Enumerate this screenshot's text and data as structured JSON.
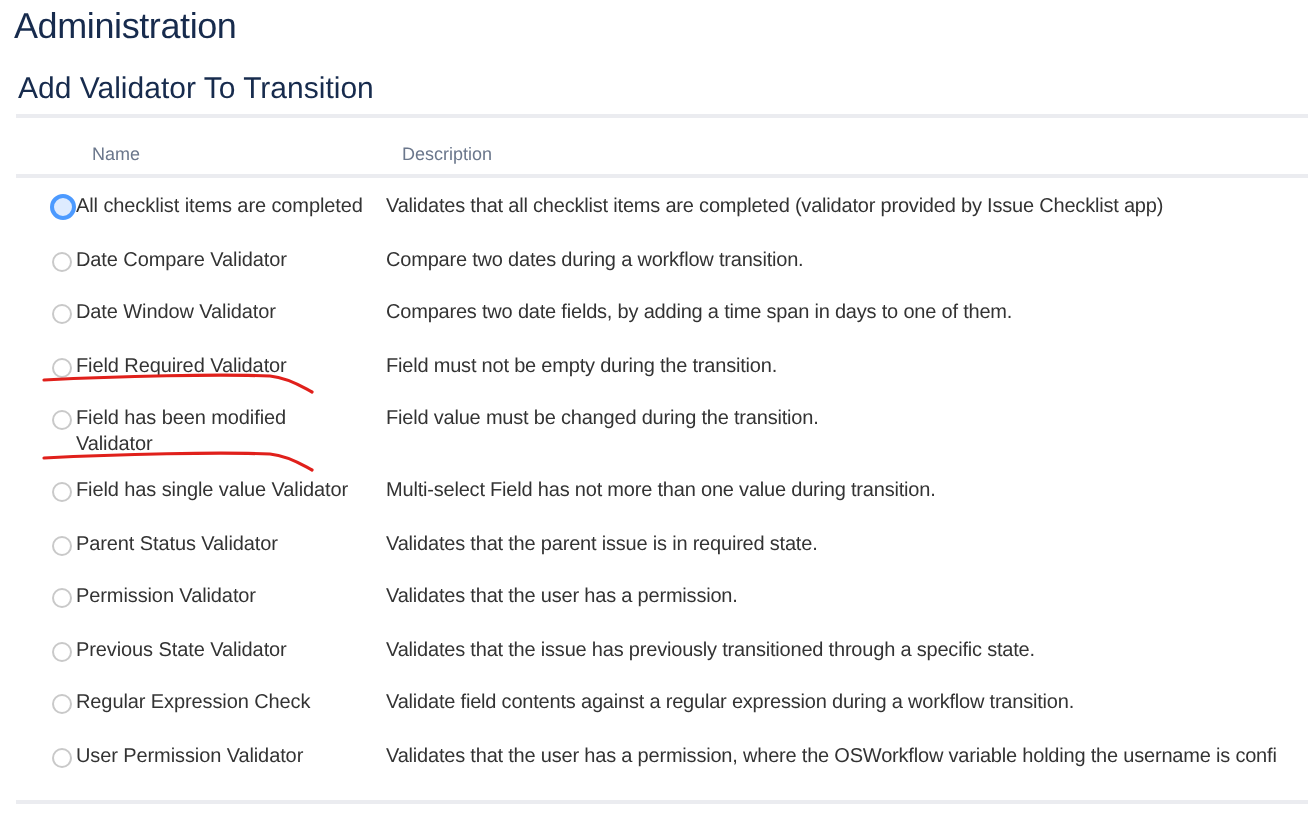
{
  "page_title": "Administration",
  "section_title": "Add Validator To Transition",
  "table": {
    "columns": [
      "Name",
      "Description"
    ],
    "rows": [
      {
        "name": "All checklist items are completed",
        "description": "Validates that all checklist items are completed (validator provided by Issue Checklist app)",
        "selected": true,
        "underlined": false
      },
      {
        "name": "Date Compare Validator",
        "description": "Compare two dates during a workflow transition.",
        "selected": false,
        "underlined": false
      },
      {
        "name": "Date Window Validator",
        "description": "Compares two date fields, by adding a time span in days to one of them.",
        "selected": false,
        "underlined": false
      },
      {
        "name": "Field Required Validator",
        "description": "Field must not be empty during the transition.",
        "selected": false,
        "underlined": true
      },
      {
        "name": "Field has been modified Validator",
        "description": "Field value must be changed during the transition.",
        "selected": false,
        "underlined": true
      },
      {
        "name": "Field has single value Validator",
        "description": "Multi-select Field has not more than one value during transition.",
        "selected": false,
        "underlined": false
      },
      {
        "name": "Parent Status Validator",
        "description": "Validates that the parent issue is in required state.",
        "selected": false,
        "underlined": false
      },
      {
        "name": "Permission Validator",
        "description": "Validates that the user has a permission.",
        "selected": false,
        "underlined": false
      },
      {
        "name": "Previous State Validator",
        "description": "Validates that the issue has previously transitioned through a specific state.",
        "selected": false,
        "underlined": false
      },
      {
        "name": "Regular Expression Check",
        "description": "Validate field contents against a regular expression during a workflow transition.",
        "selected": false,
        "underlined": false
      },
      {
        "name": "User Permission Validator",
        "description": "Validates that the user has a permission, where the OSWorkflow variable holding the username is confi",
        "selected": false,
        "underlined": false
      }
    ]
  }
}
